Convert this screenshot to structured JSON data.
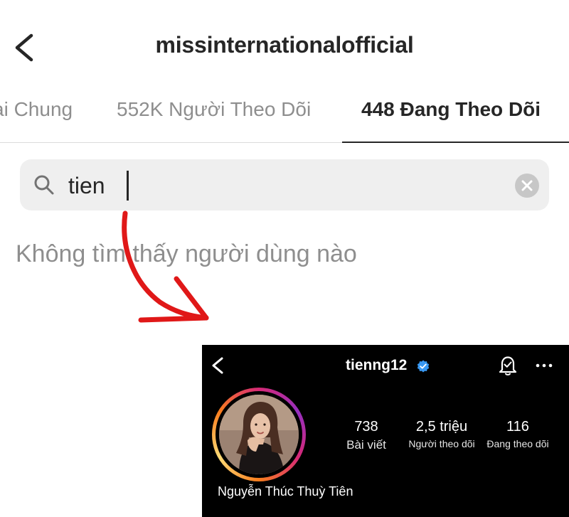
{
  "header": {
    "title": "missinternationalofficial",
    "back_icon": "chevron-left-icon"
  },
  "tabs": [
    {
      "label": "ại Chung",
      "active": false
    },
    {
      "label": "552K Người Theo Dõi",
      "active": false
    },
    {
      "label": "448 Đang Theo Dõi",
      "active": true
    }
  ],
  "search": {
    "value": "tien",
    "placeholder": "",
    "icon": "search-icon",
    "clear_icon": "clear-icon"
  },
  "empty_state": {
    "text": "Không tìm thấy người dùng nào"
  },
  "annotation": {
    "arrow_color": "#e01818"
  },
  "profile": {
    "username": "tienng12",
    "verified": true,
    "display_name": "Nguyễn Thúc Thuỳ Tiên",
    "stats": {
      "posts": {
        "value": "738",
        "label": "Bài viết"
      },
      "followers": {
        "value": "2,5 triệu",
        "label": "Người theo dõi"
      },
      "following": {
        "value": "116",
        "label": "Đang theo dõi"
      }
    },
    "icons": [
      "chevron-left-icon",
      "verified-badge-icon",
      "bell-icon",
      "more-icon"
    ]
  },
  "colors": {
    "text_primary": "#262626",
    "text_secondary": "#8e8e8e",
    "verified_blue": "#3897f0",
    "search_bg": "#efefef"
  }
}
